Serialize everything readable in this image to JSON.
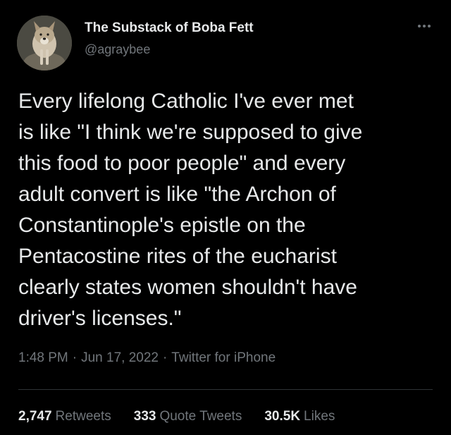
{
  "author": {
    "display_name": "The Substack of Boba Fett",
    "handle": "@agraybee"
  },
  "tweet": {
    "text": "Every lifelong Catholic I've ever met\nis like \"I think we're supposed to give\nthis food to poor people\" and every\nadult convert is like \"the Archon of\nConstantinople's epistle on the\nPentacostine rites of the eucharist\nclearly states women shouldn't have\ndriver's licenses.\"",
    "time": "1:48 PM",
    "date": "Jun 17, 2022",
    "source": "Twitter for iPhone",
    "separator": "·"
  },
  "stats": {
    "retweets_count": "2,747",
    "retweets_label": "Retweets",
    "quotes_count": "333",
    "quotes_label": "Quote Tweets",
    "likes_count": "30.5K",
    "likes_label": "Likes"
  },
  "icons": {
    "more": "more-horizontal-icon",
    "avatar": "dog-avatar"
  },
  "colors": {
    "background": "#000000",
    "primary_text": "#e7e9ea",
    "secondary_text": "#71767b",
    "divider": "#2f3336"
  }
}
